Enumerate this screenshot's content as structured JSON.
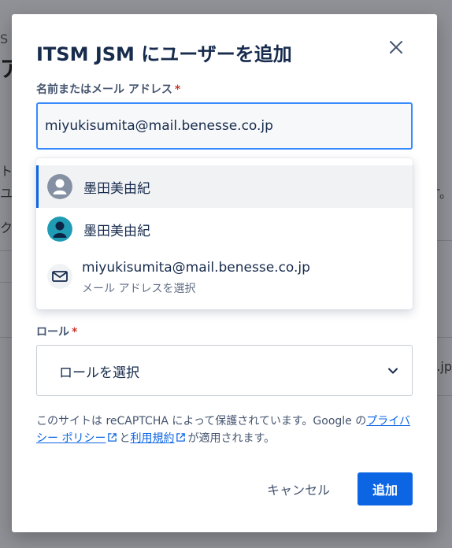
{
  "background": {
    "frag_1": "S",
    "frag_2": "ア",
    "frag_3": "ト",
    "frag_4": "ユ",
    "frag_5": "す。",
    "frag_6": "ク",
    "frag_7": ".jp"
  },
  "dialog": {
    "title": "ITSM JSM にユーザーを追加",
    "close_icon": "close-icon",
    "email_field": {
      "label": "名前またはメール アドレス",
      "required_mark": "*",
      "value": "miyukisumita@mail.benesse.co.jp"
    },
    "suggestions": [
      {
        "name": "墨田美由紀",
        "avatar": "default-user-avatar"
      },
      {
        "name": "墨田美由紀",
        "avatar": "teal-user-avatar"
      },
      {
        "email": "miyukisumita@mail.benesse.co.jp",
        "sub": "メール アドレスを選択",
        "icon": "mail-icon"
      }
    ],
    "role_field": {
      "label": "ロール",
      "required_mark": "*",
      "placeholder": "ロールを選択"
    },
    "legal": {
      "text_1": "このサイトは reCAPTCHA によって保護されています。Google の",
      "privacy_link": "プライバシー ポリシー",
      "text_2": "と",
      "terms_link": "利用規約",
      "text_3": "が適用されます。"
    },
    "buttons": {
      "cancel": "キャンセル",
      "add": "追加"
    }
  },
  "colors": {
    "accent": "#0c66e4",
    "focus_border": "#388bff",
    "required": "#c9372c",
    "overlay": "#8f9196"
  }
}
